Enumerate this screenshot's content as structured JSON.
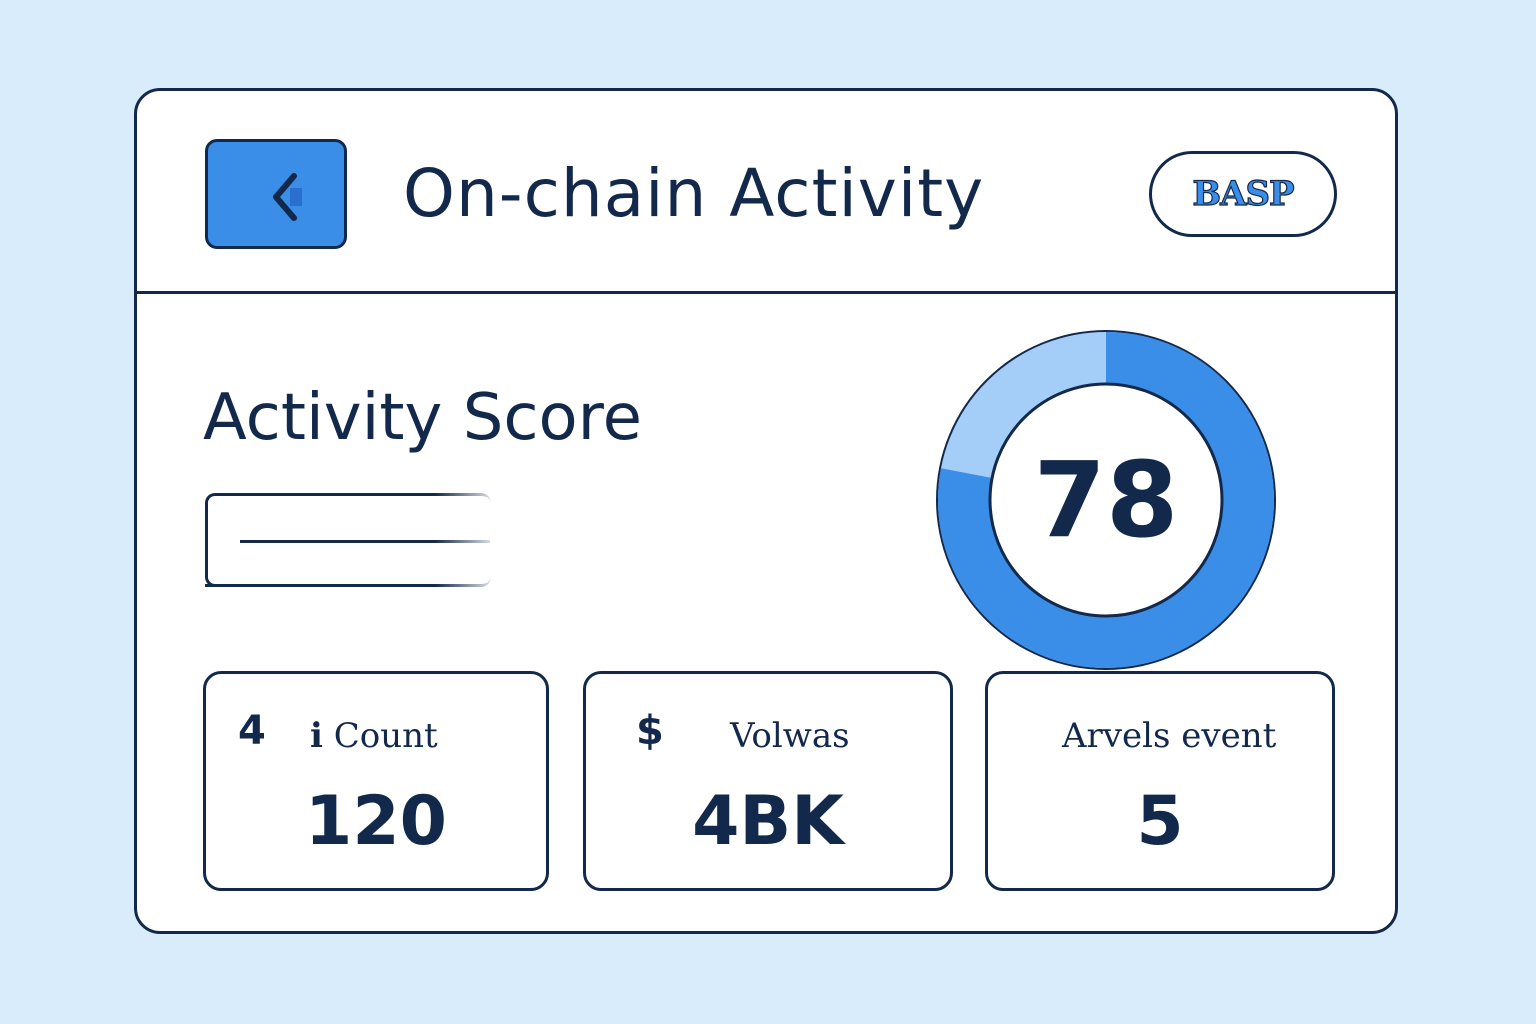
{
  "header": {
    "title": "On-chain Activity",
    "back_icon": "chevron-left-icon",
    "network_badge": "BASP"
  },
  "colors": {
    "background": "#d9ecfc",
    "accent": "#3a8ee8",
    "accent_light": "#a4cdf7",
    "ink": "#13294b"
  },
  "activity": {
    "section_title": "Activity Score",
    "score": "78",
    "score_fraction": 0.78
  },
  "stats": [
    {
      "icon": "4",
      "label": "ℹ Count",
      "value": "120"
    },
    {
      "icon": "$",
      "label": "Volwas",
      "value": "4BK"
    },
    {
      "icon": "",
      "label": "Arvels event",
      "value": "5"
    }
  ]
}
